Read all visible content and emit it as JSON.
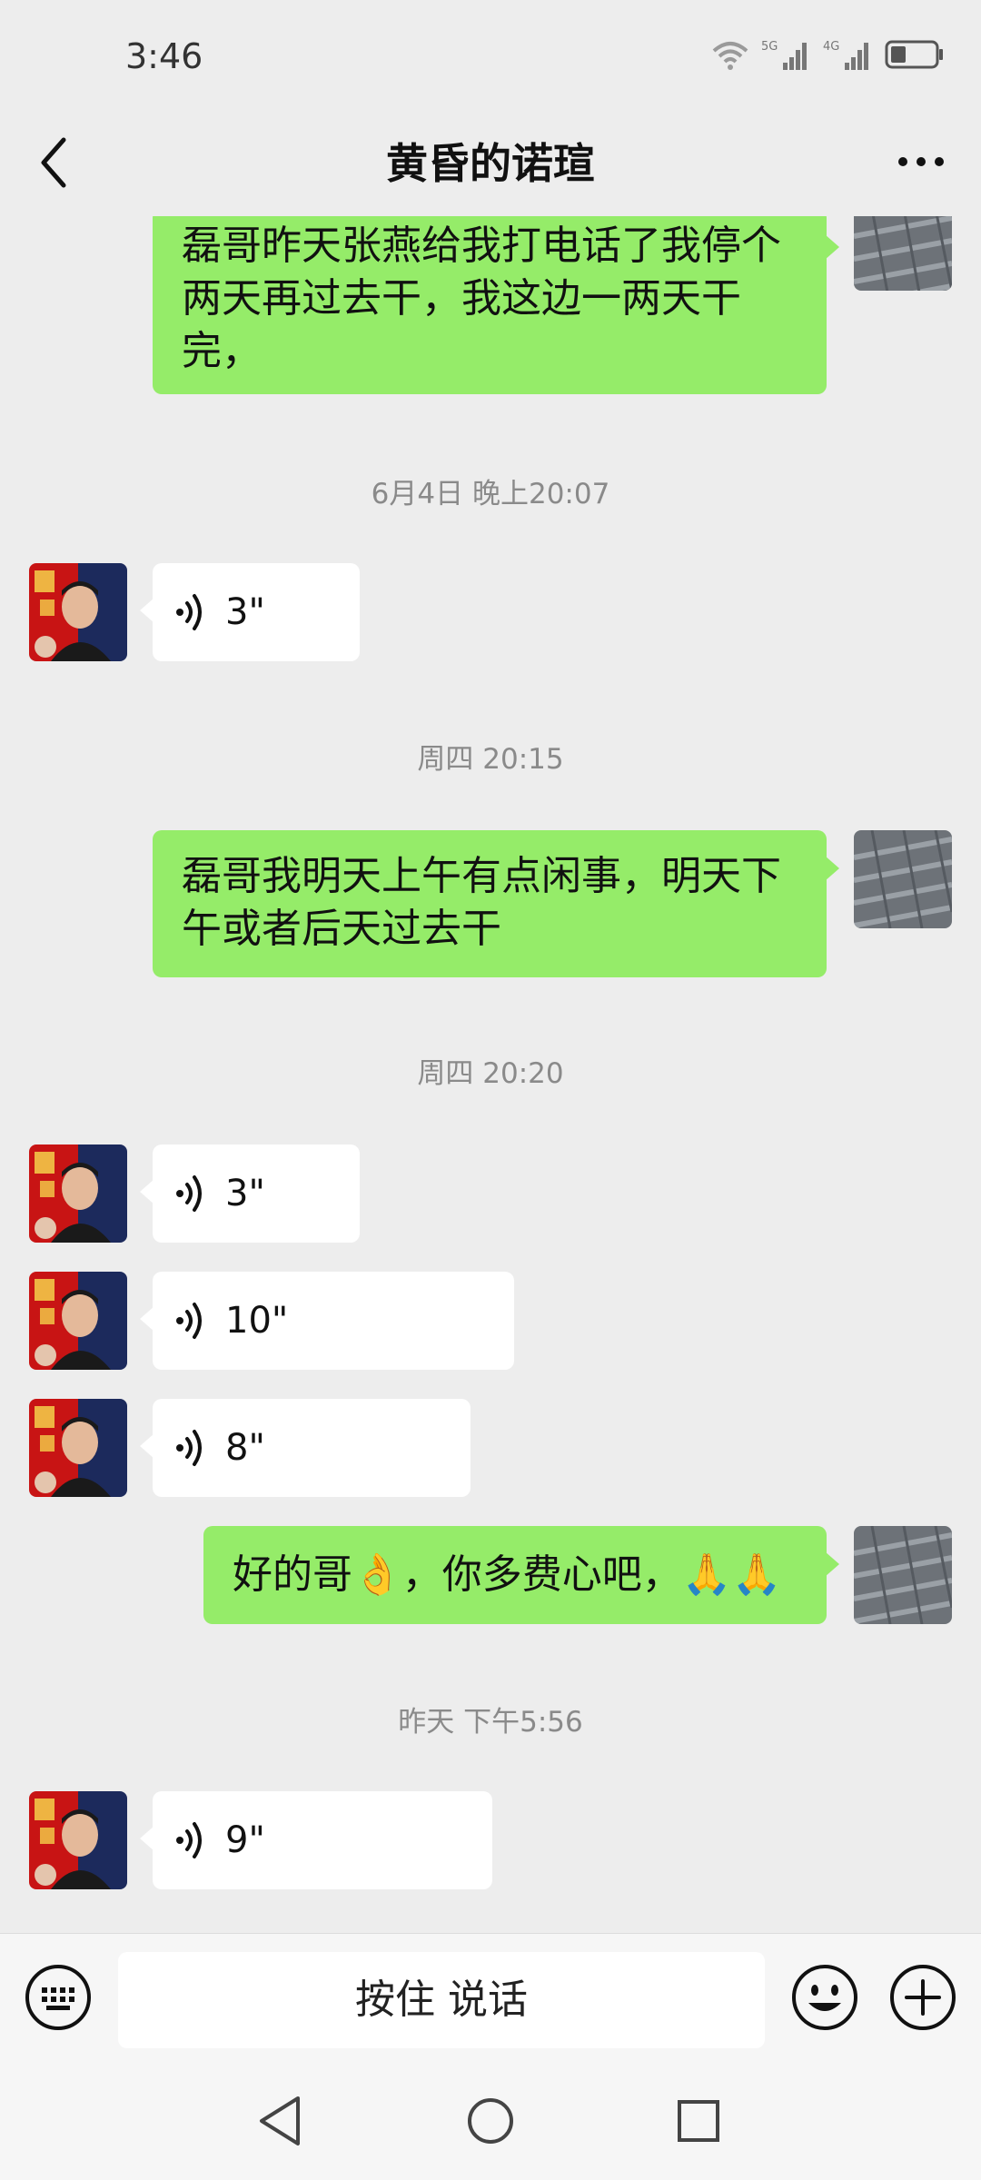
{
  "status_bar": {
    "time": "3:46",
    "signal_1": "5G",
    "signal_2": "4G"
  },
  "header": {
    "title": "黄昏的诺瑄"
  },
  "chat": {
    "msg1": {
      "lines": [
        "磊哥昨天张燕给我打电话了我停个",
        "两天再过去干，我这边一两天干",
        "完，"
      ]
    },
    "ts1": "6月4日 晚上20:07",
    "voice1": "3\"",
    "ts2": "周四 20:15",
    "msg2": {
      "lines": [
        "磊哥我明天上午有点闲事，明天下",
        "午或者后天过去干"
      ]
    },
    "ts3": "周四 20:20",
    "voice2": "3\"",
    "voice3": "10\"",
    "voice4": "8\"",
    "msg3": {
      "text_a": "好的哥",
      "emoji_ok": "👌",
      "text_b": "，你多费心吧，",
      "emoji_pray": "🙏🙏"
    },
    "ts4": "昨天 下午5:56",
    "voice5": "9\""
  },
  "input_bar": {
    "talk_label": "按住 说话"
  },
  "icons": {
    "back": "back-chevron-icon",
    "more": "more-dots-icon",
    "voice": "voice-wave-icon",
    "keyboard": "keyboard-icon",
    "emoji": "emoji-icon",
    "plus": "plus-icon",
    "wifi": "wifi-icon",
    "battery": "battery-icon"
  },
  "colors": {
    "sent_bubble": "#95ec69",
    "received_bubble": "#ffffff",
    "background": "#ededed",
    "timestamp": "#8a8a8a"
  }
}
